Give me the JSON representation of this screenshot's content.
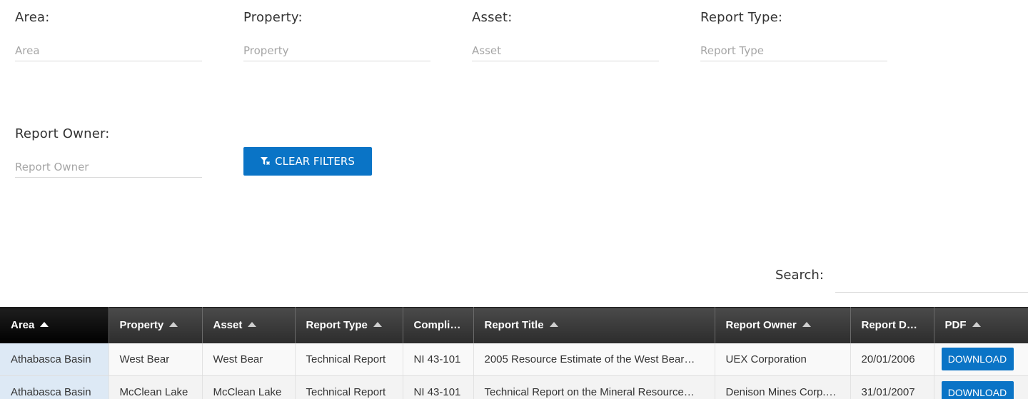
{
  "filters": {
    "area": {
      "label": "Area:",
      "placeholder": "Area"
    },
    "property": {
      "label": "Property:",
      "placeholder": "Property"
    },
    "asset": {
      "label": "Asset:",
      "placeholder": "Asset"
    },
    "report_type": {
      "label": "Report Type:",
      "placeholder": "Report Type"
    },
    "report_owner": {
      "label": "Report Owner:",
      "placeholder": "Report Owner"
    },
    "clear_label": "CLEAR FILTERS",
    "clear_icon": "filter-clear-icon"
  },
  "search": {
    "label": "Search:",
    "value": ""
  },
  "table": {
    "columns": [
      "Area",
      "Property",
      "Asset",
      "Report Type",
      "Compli…",
      "Report Title",
      "Report Owner",
      "Report D…",
      "PDF"
    ],
    "rows": [
      [
        "Athabasca Basin",
        "West Bear",
        "West Bear",
        "Technical Report",
        "NI 43-101",
        "2005 Resource Estimate of the West Bear…",
        "UEX Corporation",
        "20/01/2006",
        "DOWNLOAD"
      ],
      [
        "Athabasca Basin",
        "McClean Lake",
        "McClean Lake",
        "Technical Report",
        "NI 43-101",
        "Technical Report on the Mineral Resource…",
        "Denison Mines Corp.…",
        "31/01/2007",
        "DOWNLOAD"
      ]
    ]
  },
  "colors": {
    "accent": "#0a74c6",
    "header_bg": "#333333",
    "sorted_cell": "#dde9f5"
  }
}
